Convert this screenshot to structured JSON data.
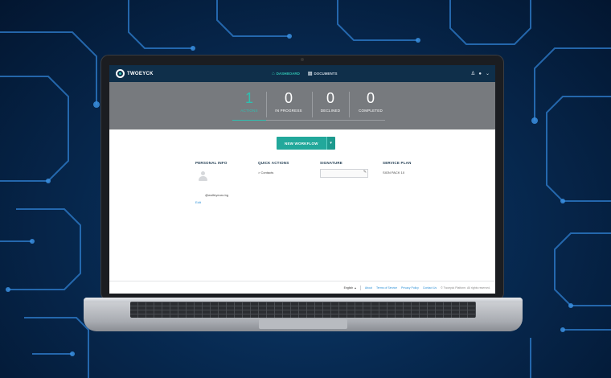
{
  "header": {
    "logo_name": "TWOEYCK",
    "logo_tagline": "",
    "nav": [
      {
        "label": "DASHBOARD",
        "icon": "home-icon",
        "active": true
      },
      {
        "label": "DOCUMENTS",
        "icon": "documents-icon",
        "active": false
      }
    ],
    "bell_icon": "Δ",
    "user_icon": "●",
    "chevron_icon": "⌄"
  },
  "stats": [
    {
      "value": "1",
      "label": "ACTIONS",
      "active": true
    },
    {
      "value": "0",
      "label": "IN PROGRESS",
      "active": false
    },
    {
      "value": "0",
      "label": "DECLINED",
      "active": false
    },
    {
      "value": "0",
      "label": "COMPLETED",
      "active": false
    }
  ],
  "workflow_button": {
    "label": "NEW WORKFLOW",
    "caret": "▾"
  },
  "personal_info": {
    "title": "PERSONAL INFO",
    "email": "@wolfeyeuro.bg",
    "edit_label": "Edit"
  },
  "quick_actions": {
    "title": "QUICK ACTIONS",
    "items": [
      "> Contacts"
    ]
  },
  "signature": {
    "title": "SIGNATURE",
    "edit_icon": "✎"
  },
  "service_plan": {
    "title": "SERVICE PLAN",
    "value": "SIGN PACK 10"
  },
  "footer": {
    "language": "English",
    "language_caret": "▴",
    "links": [
      "About",
      "Terms of Service",
      "Privacy Policy",
      "Contact Us"
    ],
    "copyright": "© Twoeyck Platform. All rights reserved."
  },
  "colors": {
    "header_bg": "#0f2f4a",
    "accent": "#2fbfb0",
    "stats_bg": "#777a7e",
    "button": "#22a89b",
    "link": "#2a8fd6"
  }
}
